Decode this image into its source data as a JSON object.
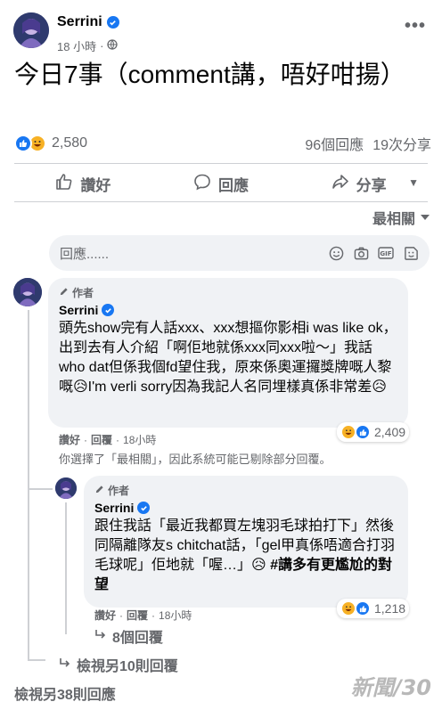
{
  "post": {
    "author": "Serrini",
    "time": "18 小時",
    "more_label": "•••",
    "text": "今日7事（comment講，唔好咁揚）",
    "reactions_count": "2,580",
    "comments_count": "96個回應",
    "shares_count": "19次分享"
  },
  "actions": {
    "like": "讚好",
    "comment": "回應",
    "share": "分享"
  },
  "sort_label": "最相關",
  "reply_box": {
    "placeholder": "回應......"
  },
  "comment1": {
    "badge": "作者",
    "name": "Serrini",
    "text": "頭先show完有人話xxx、xxx想摳你影相i was like ok，出到去有人介紹「啊佢地就係xxx同xxx啦～」我話who dat但係我個fd望住我，原來係奧運攞獎牌嘅人黎嘅😥I'm verli sorry因為我記人名同埋樣真係非常差😥",
    "like": "讚好",
    "reply": "回覆",
    "time": "18小時",
    "reactions": "2,409"
  },
  "notice": "你選擇了「最相關」，因此系統可能已剔除部分回覆。",
  "comment2": {
    "badge": "作者",
    "name": "Serrini",
    "text": "跟住我話「最近我都買左塊羽毛球拍打下」然後同隔離隊友s chitchat話，「gel甲真係唔適合打羽毛球呢」佢地就「喔…」😥",
    "hashtag": "#講多有更尷尬的對望",
    "like": "讚好",
    "reply": "回覆",
    "time": "18小時",
    "reactions": "1,218"
  },
  "replies_link": "8個回覆",
  "more_replies_link": "檢視另10則回覆",
  "more_comments_link": "檢視另38則回應",
  "watermark": "新聞/30",
  "colors": {
    "accent": "#1877f2",
    "muted": "#65676b",
    "bubble": "#f0f2f5"
  }
}
